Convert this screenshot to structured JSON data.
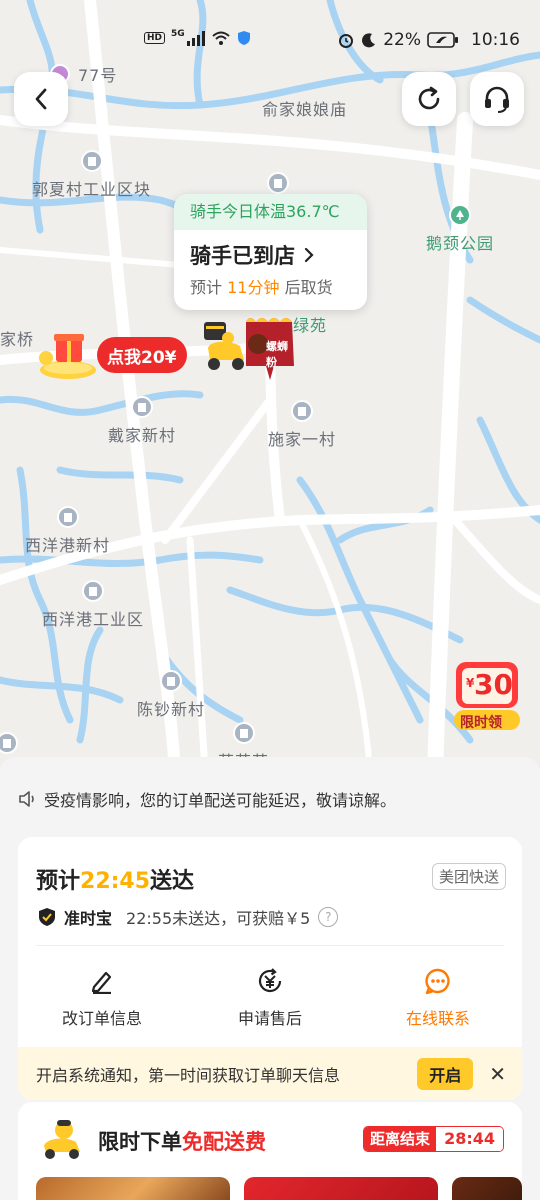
{
  "status_bar": {
    "network_badge": "HD",
    "signal_label": "5G",
    "battery": "22%",
    "time": "10:16"
  },
  "map": {
    "places": {
      "address_partial": "77号",
      "yujianiang_temple": "俞家娘娘庙",
      "guoxia_industrial": "郭夏村工业区块",
      "equ_park": "鹅颈公园",
      "lvyuan": "绿苑",
      "jiaqiao": "家桥",
      "daijia_village": "戴家新村",
      "shijia_village": "施家一村",
      "xiyanggang_village": "西洋港新村",
      "xiyanggang_industrial": "西洋港工业区",
      "chenchao_village": "陈钞新村",
      "partial_label": "荷花苑"
    },
    "rider_bubble": {
      "temperature": "骑手今日体温36.7℃",
      "status": "骑手已到店",
      "eta_prefix": "预计",
      "eta_value": "11分钟",
      "eta_suffix": "后取货"
    },
    "promo_tag": "点我20¥",
    "shop_sign": "螺蛳粉",
    "float_coupon": {
      "amount": "30",
      "currency": "¥",
      "label": "限时领"
    },
    "icons": [
      "back-icon",
      "refresh-icon",
      "headset-icon"
    ]
  },
  "sheet": {
    "notice": "受疫情影响，您的订单配送可能延迟，敬请谅解。",
    "order": {
      "eta_prefix": "预计",
      "eta_time": "22:45",
      "eta_suffix": "送达",
      "delivery_tag": "美团快送",
      "ontime_label": "准时宝",
      "ontime_text": "22:55未送达，可获赔￥5",
      "help": "?"
    },
    "actions": [
      {
        "label": "改订单信息",
        "icon": "edit-icon"
      },
      {
        "label": "申请售后",
        "icon": "refund-icon"
      },
      {
        "label": "在线联系",
        "icon": "chat-icon"
      }
    ],
    "notify": {
      "text": "开启系统通知，第一时间获取订单聊天信息",
      "button": "开启",
      "close": "✕"
    },
    "promo": {
      "title_prefix": "限时下单",
      "title_highlight": "免配送费",
      "countdown_label": "距离结束",
      "countdown_value": "28:44"
    }
  },
  "colors": {
    "accent_orange": "#ff8a00",
    "accent_yellow": "#ffc92a",
    "promo_red": "#ee2b2b",
    "water": "#a9d3f2",
    "road": "#ffffff"
  }
}
